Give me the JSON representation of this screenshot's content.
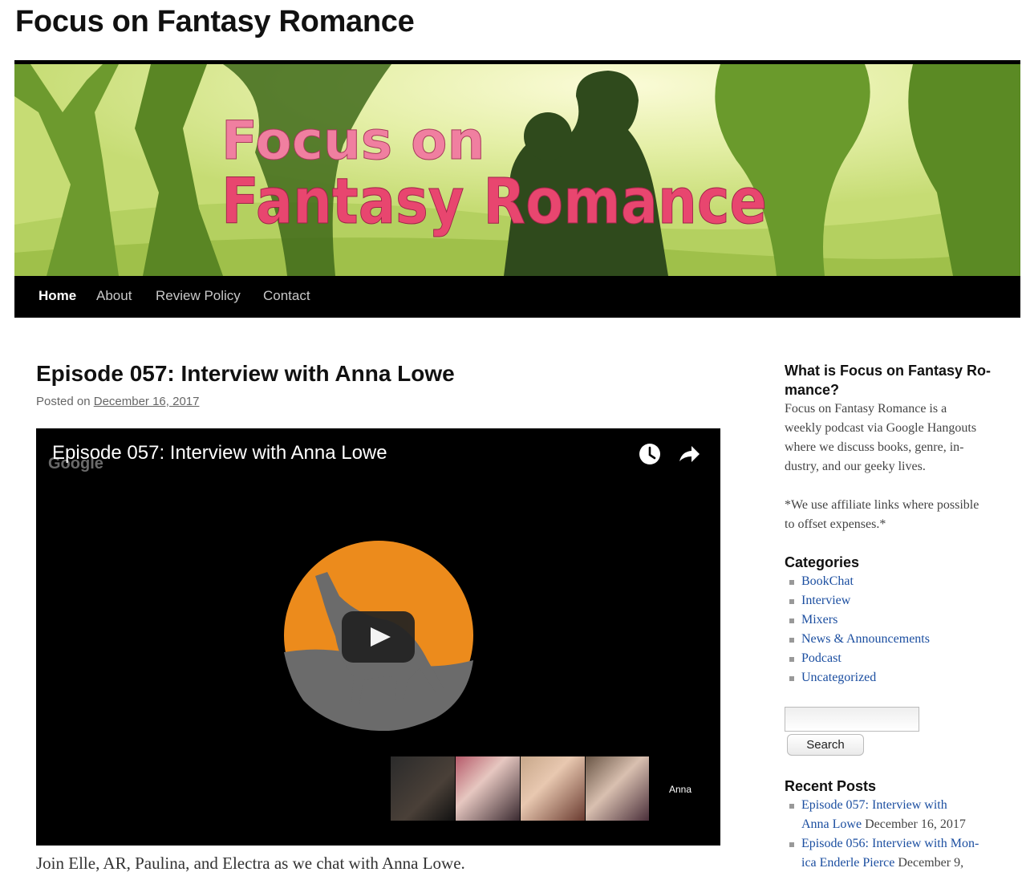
{
  "site": {
    "title": "Focus on Fantasy Romance"
  },
  "banner": {
    "line1": "Focus on",
    "line2": "Fantasy Romance"
  },
  "nav": {
    "items": [
      "Home",
      "About",
      "Review Policy",
      "Contact"
    ],
    "active": "Home"
  },
  "post": {
    "title": "Episode 057: Interview with Anna Lowe",
    "posted_on": "Posted on",
    "date": "December 16, 2017",
    "excerpt": "Join Elle, AR, Paulina, and Electra as we chat with Anna Lowe."
  },
  "video": {
    "title": "Episode 057: Interview with Anna Lowe",
    "watermark": "Google",
    "participant_label": "Anna"
  },
  "sidebar": {
    "about": {
      "title_line1": "What is Focus on Fantasy Ro-",
      "title_line2": "mance?",
      "lines": [
        "Focus on Fantasy Romance is a",
        "weekly podcast via Google Hangouts",
        "where we discuss books, genre, in-",
        "dustry, and our geeky lives."
      ],
      "note_lines": [
        "*We use affiliate links where possible",
        "to offset expenses.*"
      ]
    },
    "categories": {
      "title": "Categories",
      "items": [
        "BookChat",
        "Interview",
        "Mixers",
        "News & Announcements",
        "Podcast",
        "Uncategorized"
      ]
    },
    "search": {
      "button_label": "Search",
      "value": ""
    },
    "recent": {
      "title": "Recent Posts",
      "items": [
        {
          "line1": "Episode 057: Interview with",
          "line2_link": "Anna Lowe",
          "date": "December 16, 2017"
        },
        {
          "line1": "Episode 056: Interview with Mon-",
          "line2_link": "ica Enderle Pierce",
          "date": "December 9,"
        }
      ]
    }
  },
  "colors": {
    "link": "#1b4ea0",
    "banner_pink": "#e8466f",
    "silhouette": "#2f4a1c",
    "nav_bg": "#000000",
    "video_orange": "#ec8b1c"
  }
}
